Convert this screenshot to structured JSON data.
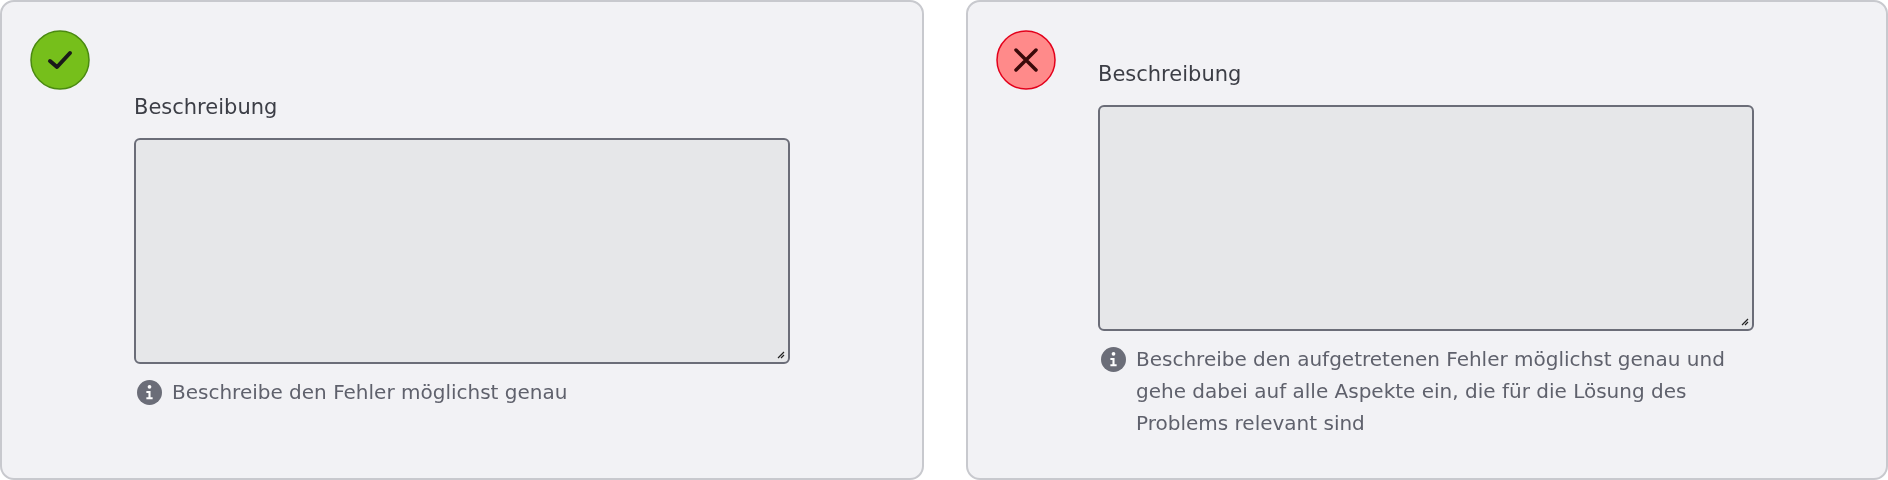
{
  "cards": [
    {
      "kind": "correct",
      "label": "Beschreibung",
      "hint": "Beschreibe den Fehler möglichst genau"
    },
    {
      "kind": "incorrect",
      "label": "Beschreibung",
      "hint": "Beschreibe den aufgetretenen Fehler möglichst genau und gehe dabei auf alle Aspekte ein, die für die Lösung des Problems relevant sind"
    }
  ]
}
